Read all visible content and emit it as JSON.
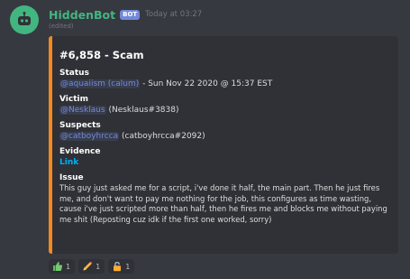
{
  "message": {
    "username": "HiddenBot",
    "bot_tag": "BOT",
    "timestamp": "Today at 03:27",
    "edited": "(edited)"
  },
  "embed": {
    "accent_color": "#f58a1f",
    "title": "#6,858 - Scam",
    "fields": {
      "status": {
        "name": "Status",
        "mention": "@aquaiism (calum)",
        "text": " - Sun Nov 22 2020 @ 15:37 EST"
      },
      "victim": {
        "name": "Victim",
        "mention": "@Nesklaus",
        "text": " (Nesklaus#3838)"
      },
      "suspects": {
        "name": "Suspects",
        "mention": "@catboyhrcca",
        "text": " (catboyhrcca#2092)"
      },
      "evidence": {
        "name": "Evidence",
        "link": "Link"
      },
      "issue": {
        "name": "Issue",
        "text": "This guy just asked me for a script, i've done it half, the main part. Then he just fires me, and don't want to pay me nothing for the job, this configures as time wasting, cause i've just scripted more than half, then he fires me and blocks me without paying me shit (Reposting cuz idk if the first one worked, sorry)"
      }
    }
  },
  "reactions": [
    {
      "icon": "thumbs-up-icon",
      "count": "1"
    },
    {
      "icon": "pencil-icon",
      "count": "1"
    },
    {
      "icon": "lock-icon",
      "count": "1"
    }
  ]
}
